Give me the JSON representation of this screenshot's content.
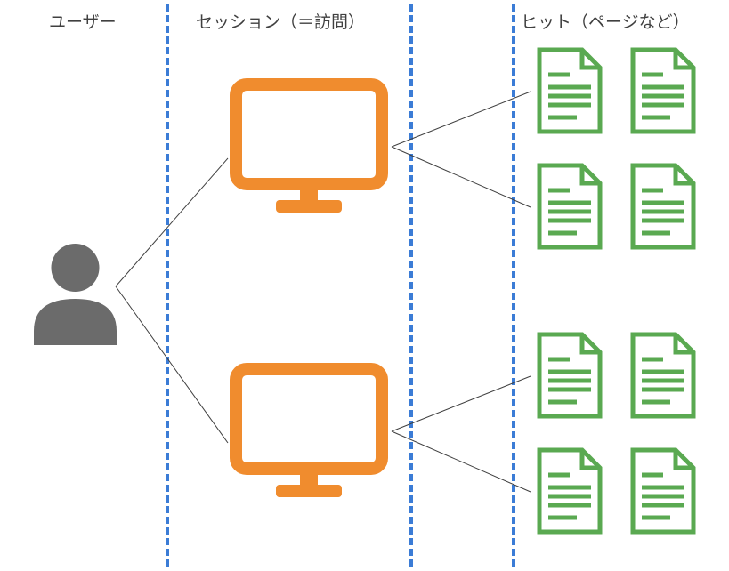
{
  "headers": {
    "user": "ユーザー",
    "session": "セッション（＝訪問）",
    "hit": "ヒット（ページなど）"
  },
  "colors": {
    "user": "#6b6b6b",
    "session": "#f08c2e",
    "hit": "#5aa951",
    "divider": "#3b7cd6",
    "line": "#404040"
  },
  "layout": {
    "columns": [
      "user",
      "session",
      "hit"
    ],
    "dividers_x": [
      186,
      460,
      575
    ],
    "sessions_per_user": 2,
    "hits_per_session": 4
  }
}
